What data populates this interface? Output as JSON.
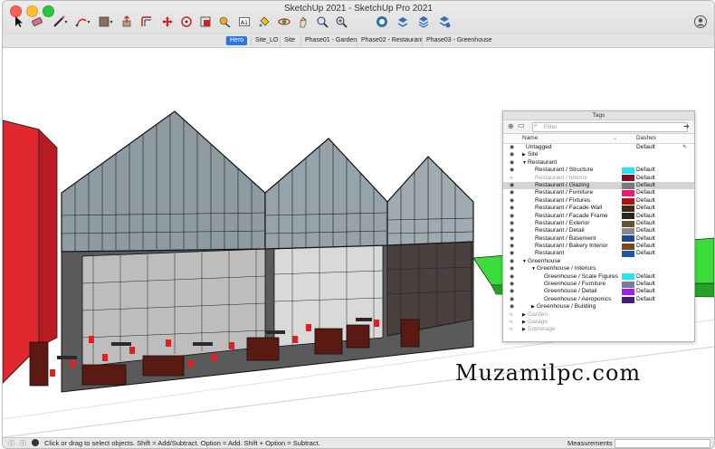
{
  "window": {
    "title": "SketchUp 2021 - SketchUp Pro 2021"
  },
  "toolbar": {
    "tools": [
      "select-tool",
      "eraser-tool",
      "line-tool",
      "arc-tool",
      "shape-tool",
      "push-pull-tool",
      "offset-tool",
      "move-tool",
      "rotate-tool",
      "scale-tool",
      "tape-measure-tool",
      "text-tool",
      "paint-bucket-tool",
      "orbit-tool",
      "pan-tool",
      "zoom-tool",
      "zoom-extents-tool",
      "warehouse",
      "extension-warehouse",
      "send-to-layout",
      "extension-manager"
    ]
  },
  "scenes": {
    "tabs": [
      {
        "label": "Hero",
        "active": true
      },
      {
        "label": "Site_LO",
        "active": false
      },
      {
        "label": "Site",
        "active": false
      },
      {
        "label": "Phase01 - Garden",
        "active": false
      },
      {
        "label": "Phase02 - Restaurant",
        "active": false
      },
      {
        "label": "Phase03 - Greenhouse",
        "active": false
      }
    ]
  },
  "tags_panel": {
    "title": "Tags",
    "filter_placeholder": "Filter",
    "col_name": "Name",
    "col_dashes": "Dashes",
    "rows": [
      {
        "name": "Untagged",
        "indent": 0,
        "arrow": "",
        "visible": true,
        "swatch": "",
        "dashes": "Default",
        "selected": false
      },
      {
        "name": "Site",
        "indent": 0,
        "arrow": "▶",
        "visible": true,
        "swatch": "",
        "dashes": "",
        "selected": false
      },
      {
        "name": "Restaurant",
        "indent": 0,
        "arrow": "▼",
        "visible": true,
        "swatch": "",
        "dashes": "",
        "selected": false
      },
      {
        "name": "Restaurant / Structure",
        "indent": 1,
        "arrow": "",
        "visible": true,
        "swatch": "#22e6f5",
        "dashes": "Default",
        "selected": false
      },
      {
        "name": "Restaurant / Interior",
        "indent": 1,
        "arrow": "",
        "visible": false,
        "swatch": "#8b0a2a",
        "dashes": "Default",
        "selected": false
      },
      {
        "name": "Restaurant / Glazing",
        "indent": 1,
        "arrow": "",
        "visible": true,
        "swatch": "#7a7a7a",
        "dashes": "Default",
        "selected": true
      },
      {
        "name": "Restaurant / Furniture",
        "indent": 1,
        "arrow": "",
        "visible": true,
        "swatch": "#f0187a",
        "dashes": "Default",
        "selected": false
      },
      {
        "name": "Restaurant / Fixtures",
        "indent": 1,
        "arrow": "",
        "visible": true,
        "swatch": "#b01010",
        "dashes": "Default",
        "selected": false
      },
      {
        "name": "Restaurant / Facade Wall",
        "indent": 1,
        "arrow": "",
        "visible": true,
        "swatch": "#3a2a1a",
        "dashes": "Default",
        "selected": false
      },
      {
        "name": "Restaurant / Facade Frame",
        "indent": 1,
        "arrow": "",
        "visible": true,
        "swatch": "#2a2520",
        "dashes": "Default",
        "selected": false
      },
      {
        "name": "Restaurant / Exterior",
        "indent": 1,
        "arrow": "",
        "visible": true,
        "swatch": "#6a5030",
        "dashes": "Default",
        "selected": false
      },
      {
        "name": "Restaurant / Detail",
        "indent": 1,
        "arrow": "",
        "visible": true,
        "swatch": "#8a8a8a",
        "dashes": "Default",
        "selected": false
      },
      {
        "name": "Restaurant / Basement",
        "indent": 1,
        "arrow": "",
        "visible": true,
        "swatch": "#1a4a8a",
        "dashes": "Default",
        "selected": false
      },
      {
        "name": "Restaurant / Bakery Interior",
        "indent": 1,
        "arrow": "",
        "visible": true,
        "swatch": "#7a4a1a",
        "dashes": "Default",
        "selected": false
      },
      {
        "name": "Restaurant",
        "indent": 1,
        "arrow": "",
        "visible": true,
        "swatch": "#1e5aa0",
        "dashes": "Default",
        "selected": false
      },
      {
        "name": "Greenhouse",
        "indent": 0,
        "arrow": "▼",
        "visible": true,
        "swatch": "",
        "dashes": "",
        "selected": false
      },
      {
        "name": "Greenhouse / Interiors",
        "indent": 1,
        "arrow": "▼",
        "visible": true,
        "swatch": "",
        "dashes": "",
        "selected": false
      },
      {
        "name": "Greenhouse / Scale Figures",
        "indent": 2,
        "arrow": "",
        "visible": true,
        "swatch": "#22e6f5",
        "dashes": "Default",
        "selected": false
      },
      {
        "name": "Greenhouse / Furniture",
        "indent": 2,
        "arrow": "",
        "visible": true,
        "swatch": "#7a7a9a",
        "dashes": "Default",
        "selected": false
      },
      {
        "name": "Greenhouse / Detail",
        "indent": 2,
        "arrow": "",
        "visible": true,
        "swatch": "#a020f0",
        "dashes": "Default",
        "selected": false
      },
      {
        "name": "Greenhouse / Aeroponics",
        "indent": 2,
        "arrow": "",
        "visible": true,
        "swatch": "#4a1a7a",
        "dashes": "Default",
        "selected": false
      },
      {
        "name": "Greenhouse / Building",
        "indent": 1,
        "arrow": "▶",
        "visible": true,
        "swatch": "",
        "dashes": "",
        "selected": false
      },
      {
        "name": "Garden",
        "indent": 0,
        "arrow": "▶",
        "visible": false,
        "swatch": "",
        "dashes": "",
        "selected": false
      },
      {
        "name": "Garage",
        "indent": 0,
        "arrow": "▶",
        "visible": false,
        "swatch": "",
        "dashes": "",
        "selected": false
      },
      {
        "name": "Entourage",
        "indent": 0,
        "arrow": "▶",
        "visible": false,
        "swatch": "",
        "dashes": "",
        "selected": false
      }
    ]
  },
  "status": {
    "message": "Click or drag to select objects. Shift = Add/Subtract. Option = Add. Shift + Option = Subtract.",
    "measurements_label": "Measurements"
  },
  "watermark": {
    "text": "Muzamilpc.com"
  }
}
